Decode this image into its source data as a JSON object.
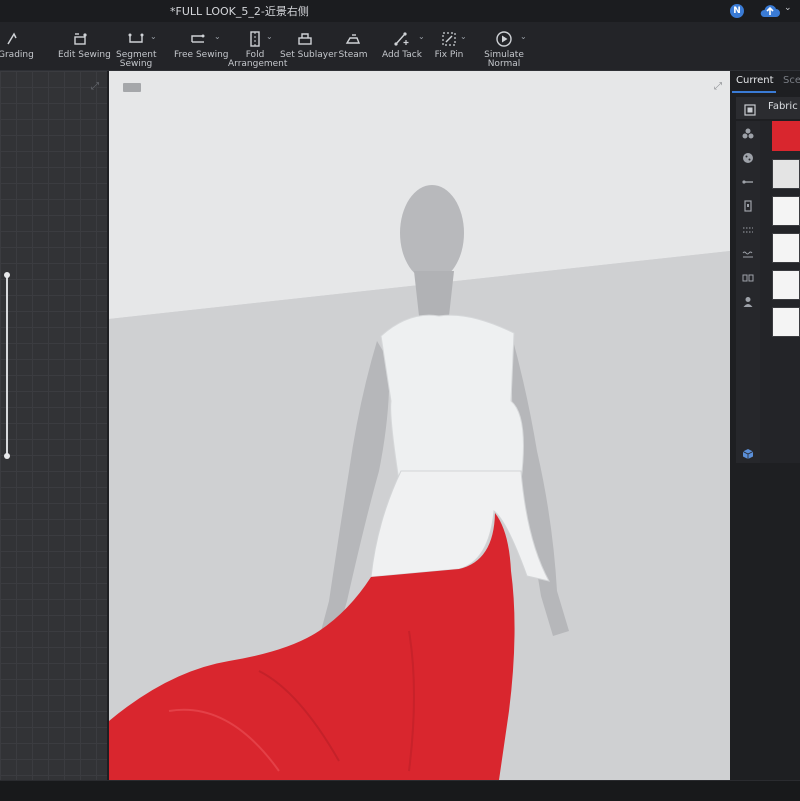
{
  "window": {
    "title": "*FULL LOOK_5_2-近景右侧",
    "user_badge": "N",
    "cloud_icon": "cloud-upload-icon"
  },
  "toolbar": {
    "tools": [
      {
        "id": "grading",
        "label": "Grading",
        "icon": "grading-icon",
        "has_menu": false
      },
      {
        "id": "edit-sewing",
        "label": "Edit Sewing",
        "icon": "edit-sewing-icon",
        "has_menu": false
      },
      {
        "id": "segment-sewing",
        "label": "Segment Sewing",
        "label_line1": "Segment",
        "label_line2": "Sewing",
        "icon": "segment-sewing-icon",
        "has_menu": true
      },
      {
        "id": "free-sewing",
        "label": "Free Sewing",
        "icon": "free-sewing-icon",
        "has_menu": true
      },
      {
        "id": "fold-arrangement",
        "label": "Fold Arrangement",
        "label_line1": "Fold",
        "label_line2": "Arrangement",
        "icon": "fold-arrangement-icon",
        "has_menu": true
      },
      {
        "id": "set-sublayer",
        "label": "Set Sublayer",
        "icon": "set-sublayer-icon",
        "has_menu": false
      },
      {
        "id": "steam",
        "label": "Steam",
        "icon": "steam-icon",
        "has_menu": false
      },
      {
        "id": "add-tack",
        "label": "Add Tack",
        "icon": "add-tack-icon",
        "has_menu": true
      },
      {
        "id": "fix-pin",
        "label": "Fix Pin",
        "icon": "fix-pin-icon",
        "has_menu": true
      },
      {
        "id": "simulate",
        "label": "Simulate Normal",
        "label_line1": "Simulate",
        "label_line2": "Normal",
        "icon": "simulate-icon",
        "has_menu": true
      }
    ]
  },
  "right_panel": {
    "tabs": [
      {
        "label": "Current",
        "active": true
      },
      {
        "label": "Scene",
        "visible_text": "Scen",
        "active": false
      }
    ],
    "section_label": "Fabric",
    "side_icons": [
      "fabric-icon",
      "button-icon",
      "buttonhole-icon",
      "zipper-icon",
      "topstitch-icon",
      "puckering-icon",
      "tape-icon",
      "avatar-icon",
      "cube-icon"
    ],
    "swatches": [
      {
        "color": "#d9262e",
        "selected": true
      },
      {
        "color": "#e4e4e4",
        "selected": false
      },
      {
        "color": "#f4f4f4",
        "selected": false
      },
      {
        "color": "#f4f4f4",
        "selected": false
      },
      {
        "color": "#f4f4f4",
        "selected": false
      },
      {
        "color": "#f4f4f4",
        "selected": false
      }
    ]
  },
  "colors": {
    "accent": "#3a7bd5",
    "fabric_red": "#d9262e",
    "viewport_bg": "#d0d1d3"
  }
}
